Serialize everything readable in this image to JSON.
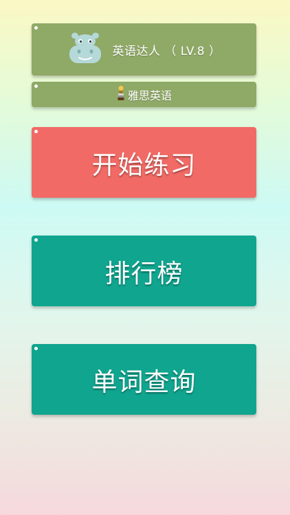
{
  "profile": {
    "title": "英语达人 （ LV.8 ）",
    "avatar_icon": "hippo-icon"
  },
  "category": {
    "label": "雅思英语",
    "icon": "trophy-icon"
  },
  "menu": {
    "start_label": "开始练习",
    "rank_label": "排行榜",
    "lookup_label": "单词查询"
  },
  "colors": {
    "profile_bg": "#8fa966",
    "start_bg": "#f16a65",
    "menu_bg": "#10a58f"
  }
}
